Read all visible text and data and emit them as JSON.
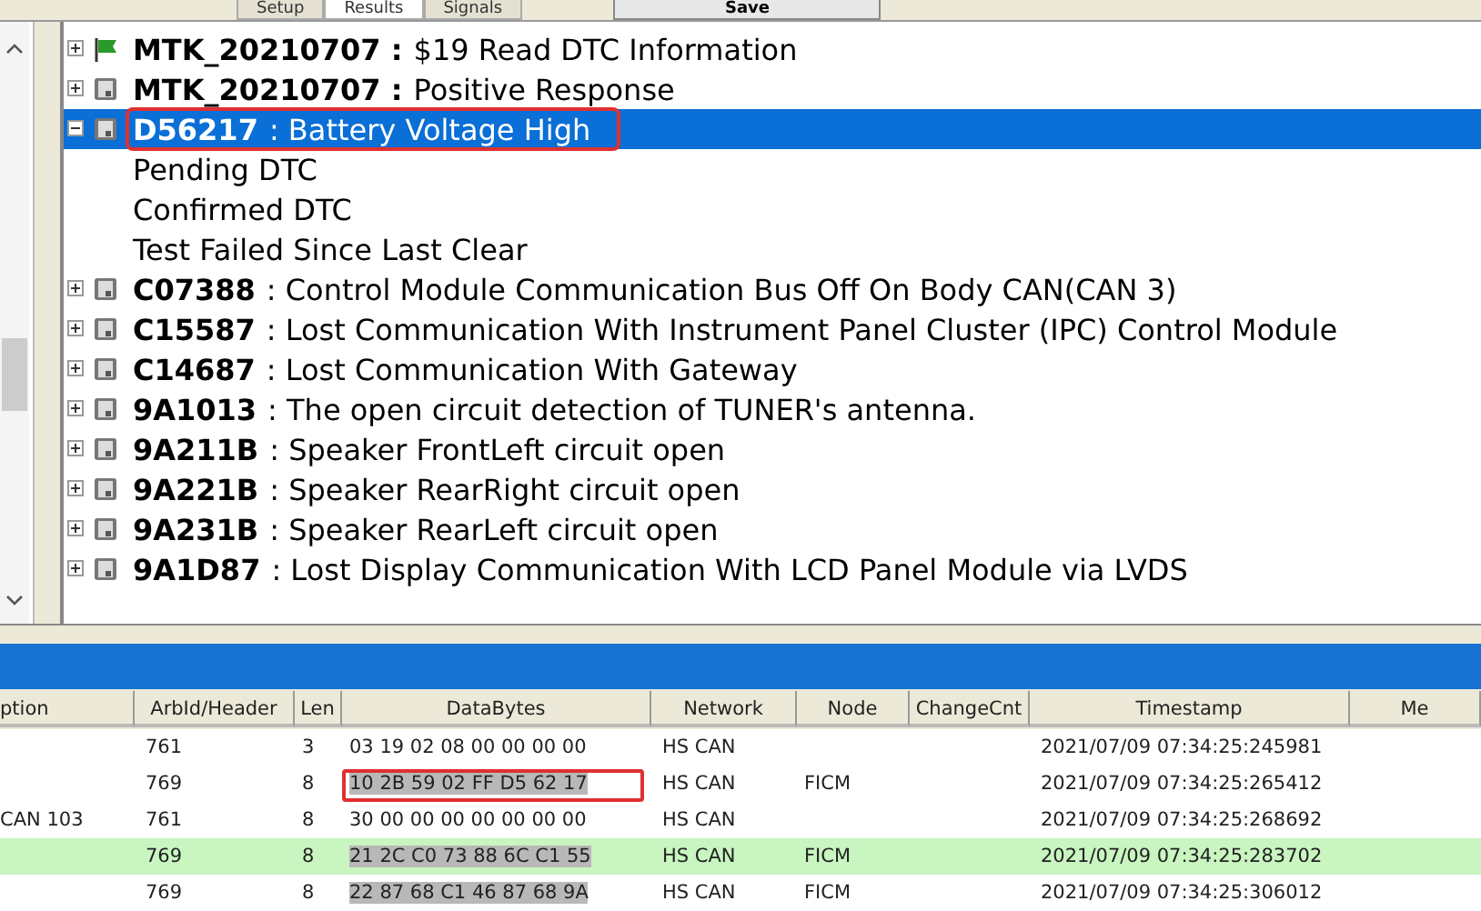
{
  "toolbar": {
    "tabs": [
      {
        "label": "Setup",
        "selected": false
      },
      {
        "label": "Results",
        "selected": true
      },
      {
        "label": "Signals",
        "selected": false
      }
    ],
    "save_button": "Save"
  },
  "tree": {
    "items": [
      {
        "kind": "flag",
        "code": "MTK_20210707 :",
        "text": "$19 Read DTC Information",
        "expanded": false,
        "selected": false,
        "annotated": false
      },
      {
        "kind": "module",
        "code": "MTK_20210707 :",
        "text": "Positive Response",
        "expanded": false,
        "selected": false,
        "annotated": false
      },
      {
        "kind": "module",
        "code": "D56217",
        "text": ": Battery Voltage High",
        "expanded": true,
        "selected": true,
        "annotated": true,
        "children": [
          {
            "text": "Pending DTC"
          },
          {
            "text": "Confirmed DTC"
          },
          {
            "text": "Test Failed Since Last Clear"
          }
        ]
      },
      {
        "kind": "module",
        "code": "C07388",
        "text": ": Control Module Communication Bus Off On Body CAN(CAN 3)",
        "expanded": false,
        "selected": false,
        "annotated": false
      },
      {
        "kind": "module",
        "code": "C15587",
        "text": ": Lost Communication With Instrument Panel Cluster (IPC) Control Module",
        "expanded": false,
        "selected": false,
        "annotated": false
      },
      {
        "kind": "module",
        "code": "C14687",
        "text": ": Lost Communication With Gateway",
        "expanded": false,
        "selected": false,
        "annotated": false
      },
      {
        "kind": "module",
        "code": "9A1013",
        "text": ": The open circuit detection of TUNER's antenna.",
        "expanded": false,
        "selected": false,
        "annotated": false
      },
      {
        "kind": "module",
        "code": "9A211B",
        "text": ": Speaker FrontLeft circuit open",
        "expanded": false,
        "selected": false,
        "annotated": false
      },
      {
        "kind": "module",
        "code": "9A221B",
        "text": ": Speaker RearRight circuit open",
        "expanded": false,
        "selected": false,
        "annotated": false
      },
      {
        "kind": "module",
        "code": "9A231B",
        "text": ": Speaker RearLeft circuit open",
        "expanded": false,
        "selected": false,
        "annotated": false
      },
      {
        "kind": "module",
        "code": "9A1D87",
        "text": ": Lost Display Communication With LCD Panel Module via LVDS",
        "expanded": false,
        "selected": false,
        "annotated": false
      }
    ]
  },
  "table": {
    "columns": [
      "ption",
      "ArbId/Header",
      "Len",
      "DataBytes",
      "Network",
      "Node",
      "ChangeCnt",
      "Timestamp",
      "Me"
    ],
    "rows": [
      {
        "highlighted": false,
        "cells": [
          "",
          "761",
          "3",
          "03 19 02 08 00 00 00 00",
          "HS CAN",
          "",
          "",
          "2021/07/09 07:34:25:245981",
          ""
        ],
        "data_shaded": false,
        "data_annotated": false
      },
      {
        "highlighted": false,
        "cells": [
          "",
          "769",
          "8",
          "10 2B 59 02 FF D5 62 17",
          "HS CAN",
          "FICM",
          "",
          "2021/07/09 07:34:25:265412",
          ""
        ],
        "data_shaded": true,
        "data_annotated": true
      },
      {
        "highlighted": false,
        "cells": [
          "CAN 103",
          "761",
          "8",
          "30 00 00 00 00 00 00 00",
          "HS CAN",
          "",
          "",
          "2021/07/09 07:34:25:268692",
          ""
        ],
        "data_shaded": false,
        "data_annotated": false
      },
      {
        "highlighted": true,
        "cells": [
          "",
          "769",
          "8",
          "21 2C C0 73 88 6C C1 55",
          "HS CAN",
          "FICM",
          "",
          "2021/07/09 07:34:25:283702",
          ""
        ],
        "data_shaded": true,
        "data_annotated": false
      },
      {
        "highlighted": false,
        "cells": [
          "",
          "769",
          "8",
          "22 87 68 C1 46 87 68 9A",
          "HS CAN",
          "FICM",
          "",
          "2021/07/09 07:34:25:306012",
          ""
        ],
        "data_shaded": true,
        "data_annotated": false
      }
    ]
  }
}
